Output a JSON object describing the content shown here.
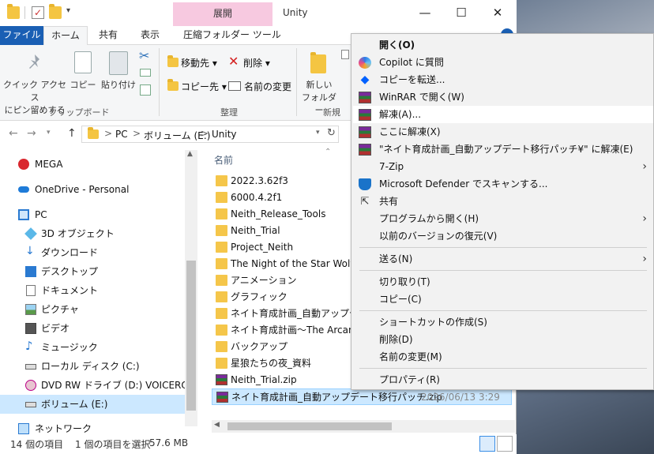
{
  "window": {
    "title": "Unity",
    "context_tab_header": "展開",
    "controls": {
      "minimize": "—",
      "maximize": "☐",
      "close": "✕"
    }
  },
  "ribbon_tabs": [
    "ファイル",
    "ホーム",
    "共有",
    "表示",
    "圧縮フォルダー ツール"
  ],
  "ribbon": {
    "clipboard": {
      "pin_label_line1": "クイック アクセス",
      "pin_label_line2": "にピン留めする",
      "copy": "コピー",
      "paste": "貼り付け",
      "group": "クリップボード"
    },
    "organize": {
      "move_to": "移動先",
      "delete": "削除",
      "copy_to": "コピー先",
      "rename": "名前の変更",
      "group": "整理"
    },
    "new": {
      "new_folder_line1": "新しい",
      "new_folder_line2": "フォルダー",
      "group": "新規"
    }
  },
  "address": {
    "segments": [
      "PC",
      "ボリューム (E:)",
      "Unity"
    ],
    "separator": ">"
  },
  "nav_pane": {
    "items": [
      {
        "label": "MEGA",
        "icon": "mega-icon"
      },
      {
        "label": "OneDrive - Personal",
        "icon": "onedrive-icon"
      },
      {
        "label": "PC",
        "icon": "pc-icon"
      },
      {
        "label": "3D オブジェクト",
        "icon": "3d-objects-icon"
      },
      {
        "label": "ダウンロード",
        "icon": "download-icon"
      },
      {
        "label": "デスクトップ",
        "icon": "desktop-icon"
      },
      {
        "label": "ドキュメント",
        "icon": "documents-icon"
      },
      {
        "label": "ピクチャ",
        "icon": "pictures-icon"
      },
      {
        "label": "ビデオ",
        "icon": "videos-icon"
      },
      {
        "label": "ミュージック",
        "icon": "music-icon"
      },
      {
        "label": "ローカル ディスク (C:)",
        "icon": "local-disk-icon"
      },
      {
        "label": "DVD RW ドライブ (D:) VOICEROID2_A",
        "icon": "dvd-drive-icon"
      },
      {
        "label": "ボリューム (E:)",
        "icon": "volume-drive-icon"
      },
      {
        "label": "ネットワーク",
        "icon": "network-icon"
      }
    ]
  },
  "file_list": {
    "column_name": "名前",
    "files": [
      {
        "name": "2022.3.62f3",
        "type": "folder"
      },
      {
        "name": "6000.4.2f1",
        "type": "folder"
      },
      {
        "name": "Neith_Release_Tools",
        "type": "folder"
      },
      {
        "name": "Neith_Trial",
        "type": "folder"
      },
      {
        "name": "Project_Neith",
        "type": "folder"
      },
      {
        "name": "The Night of the Star Wolves",
        "type": "folder"
      },
      {
        "name": "アニメーション",
        "type": "folder"
      },
      {
        "name": "グラフィック",
        "type": "folder"
      },
      {
        "name": "ネイト育成計画_自動アップデート",
        "type": "folder"
      },
      {
        "name": "ネイト育成計画〜The Arcane S",
        "type": "folder"
      },
      {
        "name": "バックアップ",
        "type": "folder"
      },
      {
        "name": "星狼たちの夜_資料",
        "type": "folder"
      },
      {
        "name": "Neith_Trial.zip",
        "type": "archive"
      },
      {
        "name": "ネイト育成計画_自動アップデート移行パッチ.zip",
        "type": "archive",
        "date": "2026/06/13 3:29"
      }
    ]
  },
  "status": {
    "count": "14 個の項目",
    "selected": "1 個の項目を選択",
    "size": "57.6 MB"
  },
  "context_menu": {
    "items": [
      {
        "label": "開く(O)",
        "bold": true
      },
      {
        "label": "Copilot に質問",
        "icon": "copilot-icon"
      },
      {
        "label": "コピーを転送...",
        "icon": "dropbox-icon"
      },
      {
        "label": "WinRAR で開く(W)",
        "icon": "winrar-icon"
      },
      {
        "label": "解凍(A)...",
        "icon": "winrar-icon",
        "hover": true
      },
      {
        "label": "ここに解凍(X)",
        "icon": "winrar-icon"
      },
      {
        "label": "\"ネイト育成計画_自動アップデート移行パッチ¥\" に解凍(E)",
        "icon": "winrar-icon"
      },
      {
        "label": "7-Zip",
        "submenu": true
      },
      {
        "label": "Microsoft Defender でスキャンする...",
        "icon": "defender-icon"
      },
      {
        "label": "共有",
        "icon": "share-icon"
      },
      {
        "label": "プログラムから開く(H)",
        "submenu": true
      },
      {
        "label": "以前のバージョンの復元(V)"
      },
      {
        "label": "送る(N)",
        "submenu": true
      },
      {
        "label": "切り取り(T)"
      },
      {
        "label": "コピー(C)"
      },
      {
        "label": "ショートカットの作成(S)"
      },
      {
        "label": "削除(D)"
      },
      {
        "label": "名前の変更(M)"
      },
      {
        "label": "プロパティ(R)"
      }
    ],
    "submenu_arrow": "›"
  },
  "colors": {
    "accent": "#1a5fb4",
    "selection": "#cce8ff",
    "context_tab": "#f7c9e0",
    "folder": "#f5c64a"
  }
}
